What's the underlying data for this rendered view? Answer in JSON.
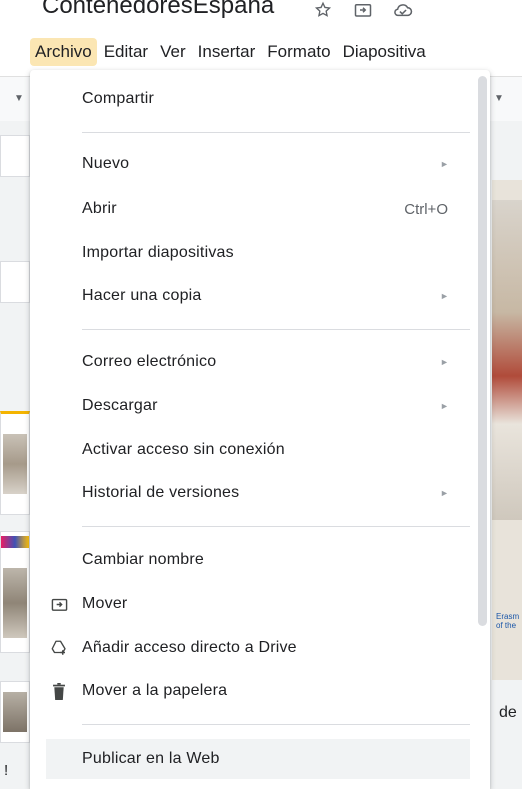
{
  "document": {
    "title": "ContenedoresEspaña"
  },
  "title_icons": [
    {
      "name": "star-icon",
      "glyph": "☆"
    },
    {
      "name": "move-to-folder-icon",
      "glyph": "⇥"
    },
    {
      "name": "cloud-status-icon",
      "glyph": "☁"
    }
  ],
  "menubar": {
    "items": [
      {
        "label": "Archivo",
        "active": true
      },
      {
        "label": "Editar"
      },
      {
        "label": "Ver"
      },
      {
        "label": "Insertar"
      },
      {
        "label": "Formato"
      },
      {
        "label": "Diapositiva"
      }
    ]
  },
  "file_menu": {
    "items": [
      {
        "label": "Compartir"
      },
      {
        "label": "Nuevo",
        "submenu": true
      },
      {
        "label": "Abrir",
        "shortcut": "Ctrl+O"
      },
      {
        "label": "Importar diapositivas"
      },
      {
        "label": "Hacer una copia",
        "submenu": true
      },
      {
        "label": "Correo electrónico",
        "submenu": true
      },
      {
        "label": "Descargar",
        "submenu": true
      },
      {
        "label": "Activar acceso sin conexión"
      },
      {
        "label": "Historial de versiones",
        "submenu": true
      },
      {
        "label": "Cambiar nombre"
      },
      {
        "label": "Mover",
        "icon": "move-icon"
      },
      {
        "label": "Añadir acceso directo a Drive",
        "icon": "add-shortcut-drive-icon"
      },
      {
        "label": "Mover a la papelera",
        "icon": "trash-icon"
      },
      {
        "label": "Publicar en la Web",
        "highlighted": true
      }
    ],
    "submenu_arrow": "►"
  },
  "background": {
    "slide_caption_line1": "Erasm",
    "slide_caption_line2": "of the",
    "text_fragment": "de",
    "left_fragment": "!"
  },
  "colors": {
    "active_menu_bg": "#fbe6b3",
    "menu_text": "#202124",
    "highlight_bg": "#f1f3f4",
    "separator": "#dadce0"
  }
}
